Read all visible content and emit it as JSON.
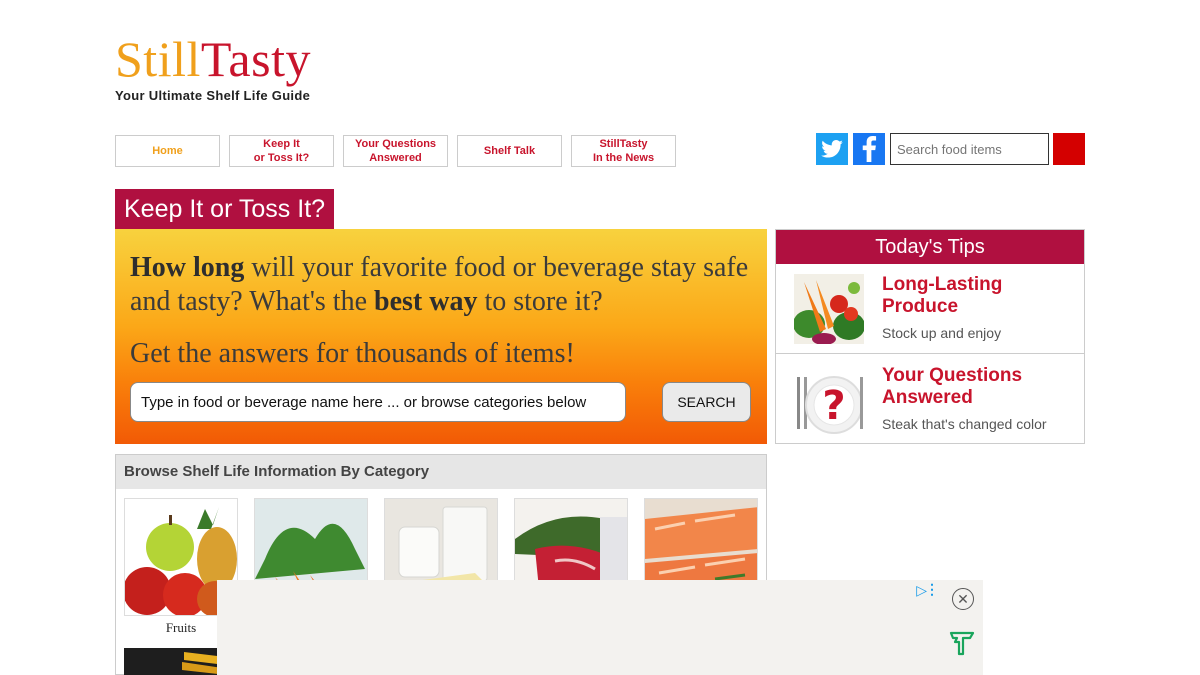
{
  "brand": {
    "logo_part1": "Still",
    "logo_part2": "Tasty",
    "tagline": "Your Ultimate Shelf Life Guide",
    "colors": {
      "orange": "#f0a01c",
      "red": "#c8142c",
      "maroon": "#b01040"
    }
  },
  "nav": {
    "items": [
      {
        "label": "Home"
      },
      {
        "label": "Keep It\nor Toss It?"
      },
      {
        "label": "Your Questions\nAnswered"
      },
      {
        "label": "Shelf Talk"
      },
      {
        "label": "StillTasty\nIn the News"
      }
    ]
  },
  "social": {
    "twitter_icon": "twitter-icon",
    "facebook_icon": "facebook-icon"
  },
  "top_search": {
    "placeholder": "Search food items"
  },
  "hero": {
    "title": "Keep It or Toss It?",
    "q_bold1": "How long",
    "q_text1": " will your favorite food or beverage stay safe and tasty? What's the ",
    "q_bold2": "best way",
    "q_text2": " to store it?",
    "answers": "Get the answers for thousands of items!",
    "input_placeholder": "Type in food or beverage name here ... or browse categories below",
    "search_button": "SEARCH"
  },
  "browse": {
    "header": "Browse Shelf Life Information By Category",
    "categories": [
      {
        "label": "Fruits"
      },
      {
        "label": ""
      },
      {
        "label": ""
      },
      {
        "label": ""
      },
      {
        "label": ""
      }
    ]
  },
  "tips": {
    "header": "Today's Tips",
    "items": [
      {
        "title": "Long-Lasting Produce",
        "subtitle": "Stock up and enjoy"
      },
      {
        "title": "Your Questions Answered",
        "subtitle": "Steak that's changed color"
      }
    ]
  },
  "ad": {
    "close_icon": "close-icon",
    "adchoices_icon": "adchoices-icon"
  }
}
